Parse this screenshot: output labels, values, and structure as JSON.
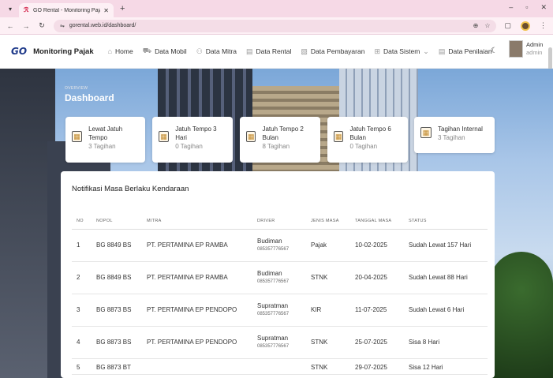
{
  "browser": {
    "tab_title": "GO Rental - Monitoring Pajak",
    "url": "gorental.web.id/dashboard/"
  },
  "app": {
    "logo_text": "GO",
    "brand": "Monitoring Pajak",
    "nav": [
      {
        "label": "Home",
        "icon": "home-icon"
      },
      {
        "label": "Data Mobil",
        "icon": "car-icon"
      },
      {
        "label": "Data Mitra",
        "icon": "partners-icon"
      },
      {
        "label": "Data Rental",
        "icon": "document-icon"
      },
      {
        "label": "Data Pembayaran",
        "icon": "payment-icon"
      },
      {
        "label": "Data Sistem",
        "icon": "system-icon"
      },
      {
        "label": "Data Penilaian",
        "icon": "rating-icon"
      }
    ],
    "user": {
      "name": "Admin",
      "role": "admin"
    }
  },
  "header": {
    "eyebrow": "OVERVIEW",
    "title": "Dashboard"
  },
  "cards": [
    {
      "title": "Lewat Jatuh Tempo",
      "count": "3 Tagihan"
    },
    {
      "title": "Jatuh Tempo 3 Hari",
      "count": "0 Tagihan"
    },
    {
      "title": "Jatuh Tempo 2 Bulan",
      "count": "8 Tagihan"
    },
    {
      "title": "Jatuh Tempo 6 Bulan",
      "count": "0 Tagihan"
    },
    {
      "title": "Tagihan Internal",
      "count": "3 Tagihan"
    }
  ],
  "panel": {
    "title": "Notifikasi Masa Berlaku Kendaraan",
    "columns": [
      "NO",
      "NOPOL",
      "MITRA",
      "DRIVER",
      "JENIS MASA",
      "TANGGAL MASA",
      "STATUS"
    ],
    "rows": [
      {
        "no": "1",
        "nopol": "BG 8849 BS",
        "mitra": "PT. PERTAMINA EP RAMBA",
        "driver": "Budiman",
        "phone": "085357776567",
        "jenis": "Pajak",
        "tanggal": "10-02-2025",
        "status": "Sudah Lewat 157 Hari"
      },
      {
        "no": "2",
        "nopol": "BG 8849 BS",
        "mitra": "PT. PERTAMINA EP RAMBA",
        "driver": "Budiman",
        "phone": "085357776567",
        "jenis": "STNK",
        "tanggal": "20-04-2025",
        "status": "Sudah Lewat 88 Hari"
      },
      {
        "no": "3",
        "nopol": "BG 8873 BS",
        "mitra": "PT. PERTAMINA EP PENDOPO",
        "driver": "Supratman",
        "phone": "085357776567",
        "jenis": "KIR",
        "tanggal": "11-07-2025",
        "status": "Sudah Lewat 6 Hari"
      },
      {
        "no": "4",
        "nopol": "BG 8873 BS",
        "mitra": "PT. PERTAMINA EP PENDOPO",
        "driver": "Supratman",
        "phone": "085357776567",
        "jenis": "STNK",
        "tanggal": "25-07-2025",
        "status": "Sisa 8 Hari"
      },
      {
        "no": "5",
        "nopol": "BG 8873 BT",
        "mitra": "",
        "driver": "",
        "phone": "",
        "jenis": "STNK",
        "tanggal": "29-07-2025",
        "status": "Sisa 12 Hari"
      }
    ]
  }
}
